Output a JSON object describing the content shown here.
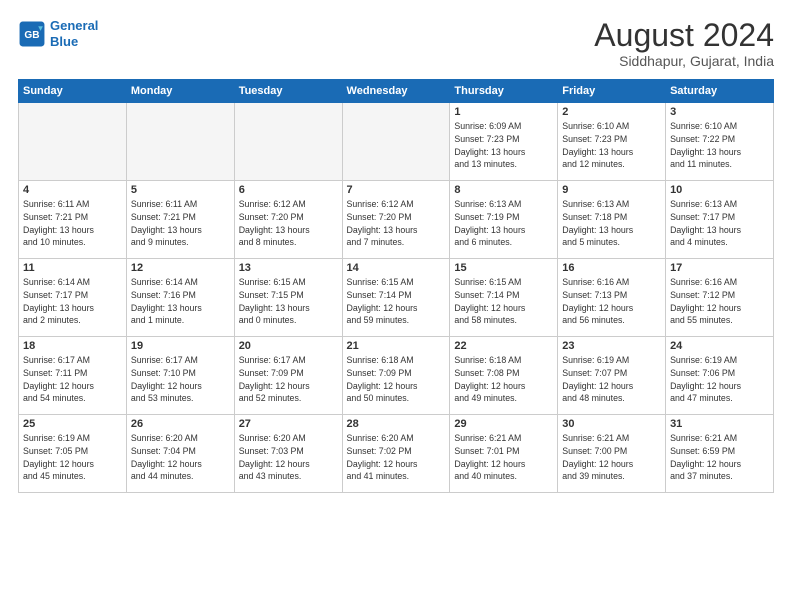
{
  "logo": {
    "line1": "General",
    "line2": "Blue"
  },
  "header": {
    "month": "August 2024",
    "location": "Siddhapur, Gujarat, India"
  },
  "weekdays": [
    "Sunday",
    "Monday",
    "Tuesday",
    "Wednesday",
    "Thursday",
    "Friday",
    "Saturday"
  ],
  "weeks": [
    [
      {
        "day": "",
        "detail": ""
      },
      {
        "day": "",
        "detail": ""
      },
      {
        "day": "",
        "detail": ""
      },
      {
        "day": "",
        "detail": ""
      },
      {
        "day": "1",
        "detail": "Sunrise: 6:09 AM\nSunset: 7:23 PM\nDaylight: 13 hours\nand 13 minutes."
      },
      {
        "day": "2",
        "detail": "Sunrise: 6:10 AM\nSunset: 7:23 PM\nDaylight: 13 hours\nand 12 minutes."
      },
      {
        "day": "3",
        "detail": "Sunrise: 6:10 AM\nSunset: 7:22 PM\nDaylight: 13 hours\nand 11 minutes."
      }
    ],
    [
      {
        "day": "4",
        "detail": "Sunrise: 6:11 AM\nSunset: 7:21 PM\nDaylight: 13 hours\nand 10 minutes."
      },
      {
        "day": "5",
        "detail": "Sunrise: 6:11 AM\nSunset: 7:21 PM\nDaylight: 13 hours\nand 9 minutes."
      },
      {
        "day": "6",
        "detail": "Sunrise: 6:12 AM\nSunset: 7:20 PM\nDaylight: 13 hours\nand 8 minutes."
      },
      {
        "day": "7",
        "detail": "Sunrise: 6:12 AM\nSunset: 7:20 PM\nDaylight: 13 hours\nand 7 minutes."
      },
      {
        "day": "8",
        "detail": "Sunrise: 6:13 AM\nSunset: 7:19 PM\nDaylight: 13 hours\nand 6 minutes."
      },
      {
        "day": "9",
        "detail": "Sunrise: 6:13 AM\nSunset: 7:18 PM\nDaylight: 13 hours\nand 5 minutes."
      },
      {
        "day": "10",
        "detail": "Sunrise: 6:13 AM\nSunset: 7:17 PM\nDaylight: 13 hours\nand 4 minutes."
      }
    ],
    [
      {
        "day": "11",
        "detail": "Sunrise: 6:14 AM\nSunset: 7:17 PM\nDaylight: 13 hours\nand 2 minutes."
      },
      {
        "day": "12",
        "detail": "Sunrise: 6:14 AM\nSunset: 7:16 PM\nDaylight: 13 hours\nand 1 minute."
      },
      {
        "day": "13",
        "detail": "Sunrise: 6:15 AM\nSunset: 7:15 PM\nDaylight: 13 hours\nand 0 minutes."
      },
      {
        "day": "14",
        "detail": "Sunrise: 6:15 AM\nSunset: 7:14 PM\nDaylight: 12 hours\nand 59 minutes."
      },
      {
        "day": "15",
        "detail": "Sunrise: 6:15 AM\nSunset: 7:14 PM\nDaylight: 12 hours\nand 58 minutes."
      },
      {
        "day": "16",
        "detail": "Sunrise: 6:16 AM\nSunset: 7:13 PM\nDaylight: 12 hours\nand 56 minutes."
      },
      {
        "day": "17",
        "detail": "Sunrise: 6:16 AM\nSunset: 7:12 PM\nDaylight: 12 hours\nand 55 minutes."
      }
    ],
    [
      {
        "day": "18",
        "detail": "Sunrise: 6:17 AM\nSunset: 7:11 PM\nDaylight: 12 hours\nand 54 minutes."
      },
      {
        "day": "19",
        "detail": "Sunrise: 6:17 AM\nSunset: 7:10 PM\nDaylight: 12 hours\nand 53 minutes."
      },
      {
        "day": "20",
        "detail": "Sunrise: 6:17 AM\nSunset: 7:09 PM\nDaylight: 12 hours\nand 52 minutes."
      },
      {
        "day": "21",
        "detail": "Sunrise: 6:18 AM\nSunset: 7:09 PM\nDaylight: 12 hours\nand 50 minutes."
      },
      {
        "day": "22",
        "detail": "Sunrise: 6:18 AM\nSunset: 7:08 PM\nDaylight: 12 hours\nand 49 minutes."
      },
      {
        "day": "23",
        "detail": "Sunrise: 6:19 AM\nSunset: 7:07 PM\nDaylight: 12 hours\nand 48 minutes."
      },
      {
        "day": "24",
        "detail": "Sunrise: 6:19 AM\nSunset: 7:06 PM\nDaylight: 12 hours\nand 47 minutes."
      }
    ],
    [
      {
        "day": "25",
        "detail": "Sunrise: 6:19 AM\nSunset: 7:05 PM\nDaylight: 12 hours\nand 45 minutes."
      },
      {
        "day": "26",
        "detail": "Sunrise: 6:20 AM\nSunset: 7:04 PM\nDaylight: 12 hours\nand 44 minutes."
      },
      {
        "day": "27",
        "detail": "Sunrise: 6:20 AM\nSunset: 7:03 PM\nDaylight: 12 hours\nand 43 minutes."
      },
      {
        "day": "28",
        "detail": "Sunrise: 6:20 AM\nSunset: 7:02 PM\nDaylight: 12 hours\nand 41 minutes."
      },
      {
        "day": "29",
        "detail": "Sunrise: 6:21 AM\nSunset: 7:01 PM\nDaylight: 12 hours\nand 40 minutes."
      },
      {
        "day": "30",
        "detail": "Sunrise: 6:21 AM\nSunset: 7:00 PM\nDaylight: 12 hours\nand 39 minutes."
      },
      {
        "day": "31",
        "detail": "Sunrise: 6:21 AM\nSunset: 6:59 PM\nDaylight: 12 hours\nand 37 minutes."
      }
    ]
  ]
}
